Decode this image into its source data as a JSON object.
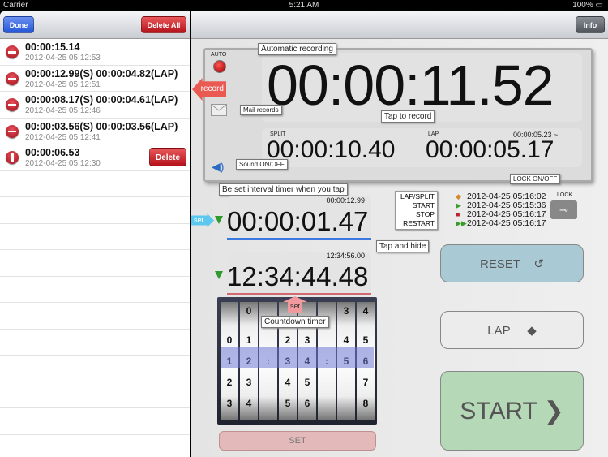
{
  "status_bar": {
    "carrier": "Carrier",
    "time": "5:21 AM",
    "battery": "100%"
  },
  "left_panel": {
    "done_label": "Done",
    "delete_all_label": "Delete All",
    "records": [
      {
        "time": "00:00:15.14",
        "date": "2012-04-25 05:12:53"
      },
      {
        "time": "00:00:12.99(S) 00:00:04.82(LAP)",
        "date": "2012-04-25 05:12:51"
      },
      {
        "time": "00:00:08.17(S) 00:00:04.61(LAP)",
        "date": "2012-04-25 05:12:46"
      },
      {
        "time": "00:00:03.56(S) 00:00:03.56(LAP)",
        "date": "2012-04-25 05:12:41"
      },
      {
        "time": "00:00:06.53",
        "date": "2012-04-25 05:12:30",
        "delete_label": "Delete"
      }
    ]
  },
  "right_panel": {
    "info_label": "Info",
    "auto_label": "AUTO",
    "main_time": "00:00:11.52",
    "split_label": "SPLIT",
    "split_time": "00:00:10.40",
    "lap_label": "LAP",
    "lap_time": "00:00:05.17",
    "lap_since": "00:00:05.23 ~",
    "interval": {
      "set_time": "00:00:12.99",
      "time": "00:00:01.47"
    },
    "countdown": {
      "set_time": "12:34:56.00",
      "time": "12:34:44.48"
    },
    "log": {
      "labels": [
        "LAP/SPLIT",
        "START",
        "STOP",
        "RESTART"
      ],
      "times": [
        "2012-04-25 05:16:02",
        "2012-04-25 05:15:36",
        "2012-04-25 05:16:17",
        "2012-04-25 05:16:17"
      ]
    },
    "lock_label": "LOCK",
    "picker": {
      "selected": "12:34:56",
      "wheels": [
        [
          "0",
          "1",
          "2",
          "3"
        ],
        [
          "0",
          "1",
          "2",
          "3",
          "4"
        ],
        [
          ":"
        ],
        [
          "2",
          "3",
          "4",
          "5"
        ],
        [
          "3",
          "4",
          "5",
          "6"
        ],
        [
          ":"
        ],
        [
          "3",
          "4",
          "5"
        ],
        [
          "4",
          "5",
          "6",
          "7",
          "8"
        ]
      ]
    },
    "set_label": "SET",
    "reset_label": "RESET",
    "lap_button_label": "LAP",
    "start_label": "START"
  },
  "callouts": {
    "auto_recording": "Automatic recording",
    "record": "record",
    "mail_records": "Mail records",
    "tap_to_record": "Tap to record",
    "sound": "Sound ON/OFF",
    "interval_tip": "Be set interval timer when you tap",
    "set": "set",
    "tap_hide": "Tap and hide",
    "countdown": "Countdown timer",
    "lock": "LOCK ON/OFF"
  },
  "colors": {
    "start": "#b5d9b6",
    "reset": "#a9c9d5",
    "lap": "#ececec",
    "set": "#e3b9b9",
    "accent_blue": "#3b79e0",
    "accent_red": "#d06a70"
  }
}
